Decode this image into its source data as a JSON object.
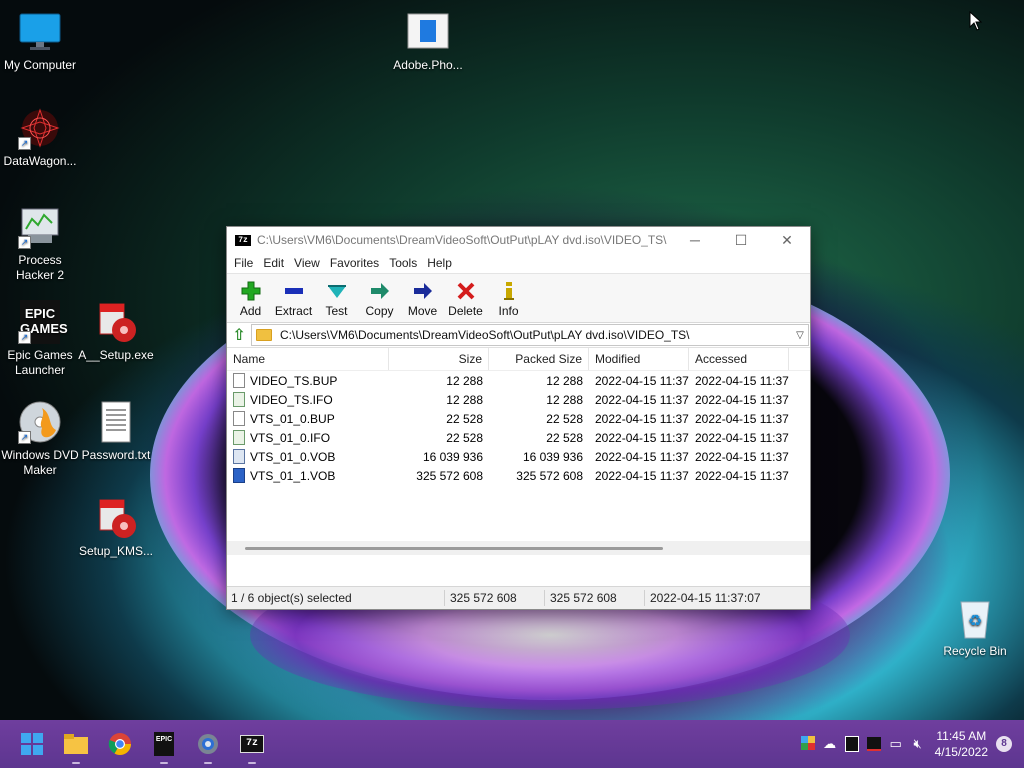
{
  "desktop": {
    "icons": [
      {
        "label": "My Computer"
      },
      {
        "label": "Adobe.Pho..."
      },
      {
        "label": "DataWagon..."
      },
      {
        "label": "Process Hacker 2"
      },
      {
        "label": "Epic Games Launcher",
        "badge": "EPIC GAMES"
      },
      {
        "label": "A__Setup.exe"
      },
      {
        "label": "Windows DVD Maker"
      },
      {
        "label": "Password.txt"
      },
      {
        "label": "Setup_KMS..."
      },
      {
        "label": "Recycle Bin"
      }
    ]
  },
  "window": {
    "app_icon": "7z",
    "title": "C:\\Users\\VM6\\Documents\\DreamVideoSoft\\OutPut\\pLAY dvd.iso\\VIDEO_TS\\",
    "menu": [
      "File",
      "Edit",
      "View",
      "Favorites",
      "Tools",
      "Help"
    ],
    "toolbar": [
      {
        "label": "Add",
        "icon": "plus-icon",
        "color": "#22a822"
      },
      {
        "label": "Extract",
        "icon": "minus-icon",
        "color": "#1a2fb8"
      },
      {
        "label": "Test",
        "icon": "check-arrow-icon",
        "color": "#1fb3b8"
      },
      {
        "label": "Copy",
        "icon": "double-arrow-icon",
        "color": "#1e8a6a"
      },
      {
        "label": "Move",
        "icon": "arrow-right-icon",
        "color": "#1a2c9a"
      },
      {
        "label": "Delete",
        "icon": "x-icon",
        "color": "#d41c1c"
      },
      {
        "label": "Info",
        "icon": "info-icon",
        "color": "#c8a800"
      }
    ],
    "address": "C:\\Users\\VM6\\Documents\\DreamVideoSoft\\OutPut\\pLAY dvd.iso\\VIDEO_TS\\",
    "columns": [
      "Name",
      "Size",
      "Packed Size",
      "Modified",
      "Accessed"
    ],
    "files": [
      {
        "name": "VIDEO_TS.BUP",
        "size": "12 288",
        "packed": "12 288",
        "modified": "2022-04-15 11:37",
        "accessed": "2022-04-15 11:37",
        "type": "bup"
      },
      {
        "name": "VIDEO_TS.IFO",
        "size": "12 288",
        "packed": "12 288",
        "modified": "2022-04-15 11:37",
        "accessed": "2022-04-15 11:37",
        "type": "ifo"
      },
      {
        "name": "VTS_01_0.BUP",
        "size": "22 528",
        "packed": "22 528",
        "modified": "2022-04-15 11:37",
        "accessed": "2022-04-15 11:37",
        "type": "bup"
      },
      {
        "name": "VTS_01_0.IFO",
        "size": "22 528",
        "packed": "22 528",
        "modified": "2022-04-15 11:37",
        "accessed": "2022-04-15 11:37",
        "type": "ifo"
      },
      {
        "name": "VTS_01_0.VOB",
        "size": "16 039 936",
        "packed": "16 039 936",
        "modified": "2022-04-15 11:37",
        "accessed": "2022-04-15 11:37",
        "type": "vob"
      },
      {
        "name": "VTS_01_1.VOB",
        "size": "325 572 608",
        "packed": "325 572 608",
        "modified": "2022-04-15 11:37",
        "accessed": "2022-04-15 11:37",
        "type": "vob2"
      }
    ],
    "status": {
      "selection": "1 / 6 object(s) selected",
      "size": "325 572 608",
      "packed": "325 572 608",
      "date": "2022-04-15 11:37:07"
    }
  },
  "taskbar": {
    "apps": [
      "windows-start-icon",
      "file-explorer-icon",
      "chrome-icon",
      "epic-games-icon",
      "settings-icon",
      "7zip-icon"
    ],
    "epic_label": "EPIC",
    "sevenzip_label": "7z",
    "time": "11:45 AM",
    "date": "4/15/2022",
    "notifications": "8"
  }
}
